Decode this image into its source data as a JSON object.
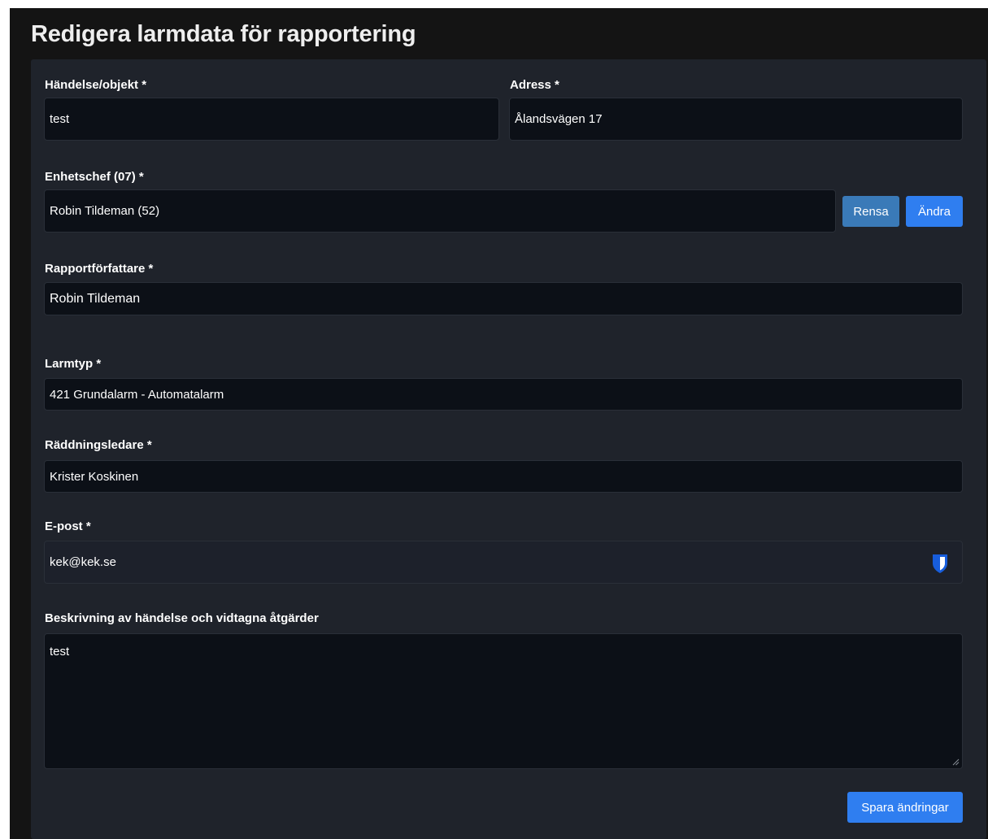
{
  "page": {
    "title": "Redigera larmdata för rapportering"
  },
  "form": {
    "handelse": {
      "label": "Händelse/objekt *",
      "value": "test"
    },
    "adress": {
      "label": "Adress *",
      "value": "Ålandsvägen 17"
    },
    "enhetschef": {
      "label": "Enhetschef (07) *",
      "value": "Robin Tildeman (52)",
      "clear_label": "Rensa",
      "change_label": "Ändra"
    },
    "rapportforfattare": {
      "label": "Rapportförfattare *",
      "value": "Robin Tildeman"
    },
    "larmtyp": {
      "label": "Larmtyp *",
      "value": "421 Grundalarm - Automatalarm"
    },
    "raddningsledare": {
      "label": "Räddningsledare *",
      "value": "Krister Koskinen"
    },
    "epost": {
      "label": "E-post *",
      "value": "kek@kek.se",
      "icon": "password-manager-shield-icon"
    },
    "beskrivning": {
      "label": "Beskrivning av händelse och vidtagna åtgärder",
      "value": "test"
    },
    "save_label": "Spara ändringar"
  },
  "colors": {
    "background": "#141414",
    "panel": "#1f232b",
    "input": "#0c1017",
    "primary": "#2f7ef0",
    "secondary": "#3a7ab8"
  }
}
